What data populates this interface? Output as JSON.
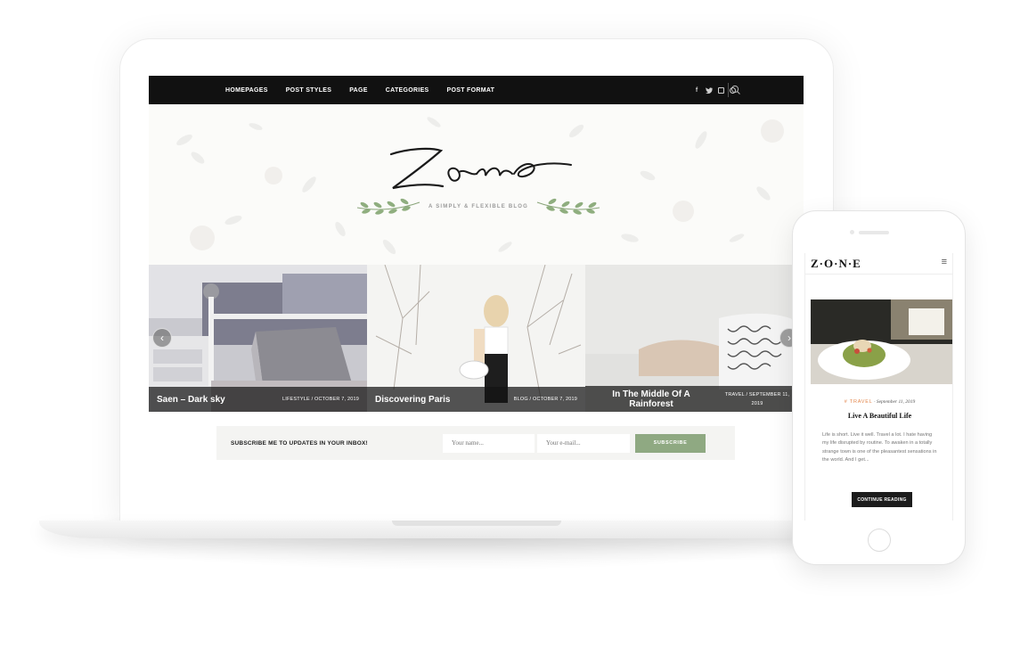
{
  "desktop": {
    "nav": {
      "items": [
        "HOMEPAGES",
        "POST STYLES",
        "PAGE",
        "CATEGORIES",
        "POST FORMAT"
      ],
      "social_icons": [
        "facebook-icon",
        "twitter-icon",
        "instagram-icon",
        "dribbble-icon"
      ],
      "search_icon": "search-icon"
    },
    "header": {
      "logo_text": "Zone",
      "tagline": "A SIMPLY & FLEXIBLE BLOG"
    },
    "slider": {
      "slides": [
        {
          "title": "Saen – Dark sky",
          "meta": "LIFESTYLE / OCTOBER 7, 2019"
        },
        {
          "title": "Discovering Paris",
          "meta": "BLOG / OCTOBER 7, 2019"
        },
        {
          "title": "In The Middle Of A Rainforest",
          "meta": "TRAVEL / SEPTEMBER 11, 2019"
        }
      ],
      "prev_icon": "‹",
      "next_icon": "›"
    },
    "subscribe": {
      "label": "SUBSCRIBE ME TO UPDATES IN YOUR INBOX!",
      "name_placeholder": "Your name...",
      "email_placeholder": "Your e-mail...",
      "button": "SUBSCRIBE",
      "button_color": "#8fa982"
    }
  },
  "mobile": {
    "logo": "Z·O·N·E",
    "menu_icon": "≡",
    "post": {
      "category": "# TRAVEL",
      "date": "September 11, 2019",
      "title": "Live A Beautiful Life",
      "excerpt": "Life is short. Live it well. Travel a lot. I hate having my life disrupted by routine. To awaken in a totally strange town is one of the pleasantest sensations in the world. And I get...",
      "button": "CONTINUE READING"
    },
    "accent_color": "#e3874c"
  }
}
